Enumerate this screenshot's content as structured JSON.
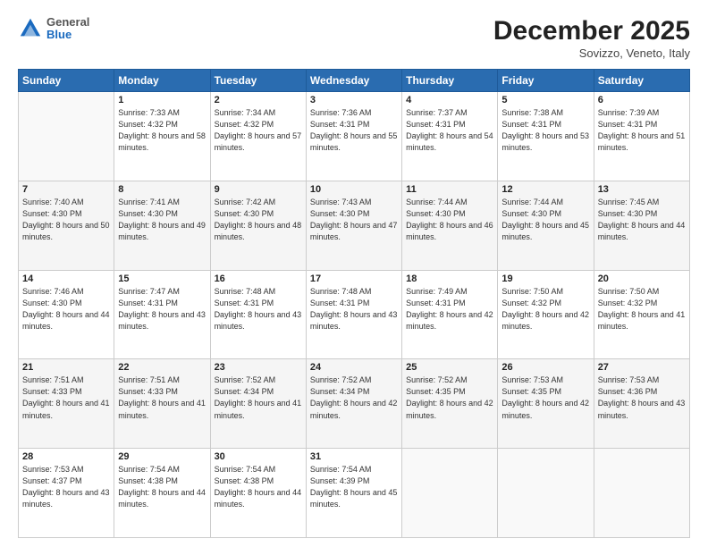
{
  "header": {
    "logo": {
      "general": "General",
      "blue": "Blue"
    },
    "title": "December 2025",
    "location": "Sovizzo, Veneto, Italy"
  },
  "calendar": {
    "days_of_week": [
      "Sunday",
      "Monday",
      "Tuesday",
      "Wednesday",
      "Thursday",
      "Friday",
      "Saturday"
    ],
    "weeks": [
      [
        {
          "day": "",
          "info": ""
        },
        {
          "day": "1",
          "info": "Sunrise: 7:33 AM\nSunset: 4:32 PM\nDaylight: 8 hours\nand 58 minutes."
        },
        {
          "day": "2",
          "info": "Sunrise: 7:34 AM\nSunset: 4:32 PM\nDaylight: 8 hours\nand 57 minutes."
        },
        {
          "day": "3",
          "info": "Sunrise: 7:36 AM\nSunset: 4:31 PM\nDaylight: 8 hours\nand 55 minutes."
        },
        {
          "day": "4",
          "info": "Sunrise: 7:37 AM\nSunset: 4:31 PM\nDaylight: 8 hours\nand 54 minutes."
        },
        {
          "day": "5",
          "info": "Sunrise: 7:38 AM\nSunset: 4:31 PM\nDaylight: 8 hours\nand 53 minutes."
        },
        {
          "day": "6",
          "info": "Sunrise: 7:39 AM\nSunset: 4:31 PM\nDaylight: 8 hours\nand 51 minutes."
        }
      ],
      [
        {
          "day": "7",
          "info": "Sunrise: 7:40 AM\nSunset: 4:30 PM\nDaylight: 8 hours\nand 50 minutes."
        },
        {
          "day": "8",
          "info": "Sunrise: 7:41 AM\nSunset: 4:30 PM\nDaylight: 8 hours\nand 49 minutes."
        },
        {
          "day": "9",
          "info": "Sunrise: 7:42 AM\nSunset: 4:30 PM\nDaylight: 8 hours\nand 48 minutes."
        },
        {
          "day": "10",
          "info": "Sunrise: 7:43 AM\nSunset: 4:30 PM\nDaylight: 8 hours\nand 47 minutes."
        },
        {
          "day": "11",
          "info": "Sunrise: 7:44 AM\nSunset: 4:30 PM\nDaylight: 8 hours\nand 46 minutes."
        },
        {
          "day": "12",
          "info": "Sunrise: 7:44 AM\nSunset: 4:30 PM\nDaylight: 8 hours\nand 45 minutes."
        },
        {
          "day": "13",
          "info": "Sunrise: 7:45 AM\nSunset: 4:30 PM\nDaylight: 8 hours\nand 44 minutes."
        }
      ],
      [
        {
          "day": "14",
          "info": "Sunrise: 7:46 AM\nSunset: 4:30 PM\nDaylight: 8 hours\nand 44 minutes."
        },
        {
          "day": "15",
          "info": "Sunrise: 7:47 AM\nSunset: 4:31 PM\nDaylight: 8 hours\nand 43 minutes."
        },
        {
          "day": "16",
          "info": "Sunrise: 7:48 AM\nSunset: 4:31 PM\nDaylight: 8 hours\nand 43 minutes."
        },
        {
          "day": "17",
          "info": "Sunrise: 7:48 AM\nSunset: 4:31 PM\nDaylight: 8 hours\nand 43 minutes."
        },
        {
          "day": "18",
          "info": "Sunrise: 7:49 AM\nSunset: 4:31 PM\nDaylight: 8 hours\nand 42 minutes."
        },
        {
          "day": "19",
          "info": "Sunrise: 7:50 AM\nSunset: 4:32 PM\nDaylight: 8 hours\nand 42 minutes."
        },
        {
          "day": "20",
          "info": "Sunrise: 7:50 AM\nSunset: 4:32 PM\nDaylight: 8 hours\nand 41 minutes."
        }
      ],
      [
        {
          "day": "21",
          "info": "Sunrise: 7:51 AM\nSunset: 4:33 PM\nDaylight: 8 hours\nand 41 minutes."
        },
        {
          "day": "22",
          "info": "Sunrise: 7:51 AM\nSunset: 4:33 PM\nDaylight: 8 hours\nand 41 minutes."
        },
        {
          "day": "23",
          "info": "Sunrise: 7:52 AM\nSunset: 4:34 PM\nDaylight: 8 hours\nand 41 minutes."
        },
        {
          "day": "24",
          "info": "Sunrise: 7:52 AM\nSunset: 4:34 PM\nDaylight: 8 hours\nand 42 minutes."
        },
        {
          "day": "25",
          "info": "Sunrise: 7:52 AM\nSunset: 4:35 PM\nDaylight: 8 hours\nand 42 minutes."
        },
        {
          "day": "26",
          "info": "Sunrise: 7:53 AM\nSunset: 4:35 PM\nDaylight: 8 hours\nand 42 minutes."
        },
        {
          "day": "27",
          "info": "Sunrise: 7:53 AM\nSunset: 4:36 PM\nDaylight: 8 hours\nand 43 minutes."
        }
      ],
      [
        {
          "day": "28",
          "info": "Sunrise: 7:53 AM\nSunset: 4:37 PM\nDaylight: 8 hours\nand 43 minutes."
        },
        {
          "day": "29",
          "info": "Sunrise: 7:54 AM\nSunset: 4:38 PM\nDaylight: 8 hours\nand 44 minutes."
        },
        {
          "day": "30",
          "info": "Sunrise: 7:54 AM\nSunset: 4:38 PM\nDaylight: 8 hours\nand 44 minutes."
        },
        {
          "day": "31",
          "info": "Sunrise: 7:54 AM\nSunset: 4:39 PM\nDaylight: 8 hours\nand 45 minutes."
        },
        {
          "day": "",
          "info": ""
        },
        {
          "day": "",
          "info": ""
        },
        {
          "day": "",
          "info": ""
        }
      ]
    ]
  }
}
